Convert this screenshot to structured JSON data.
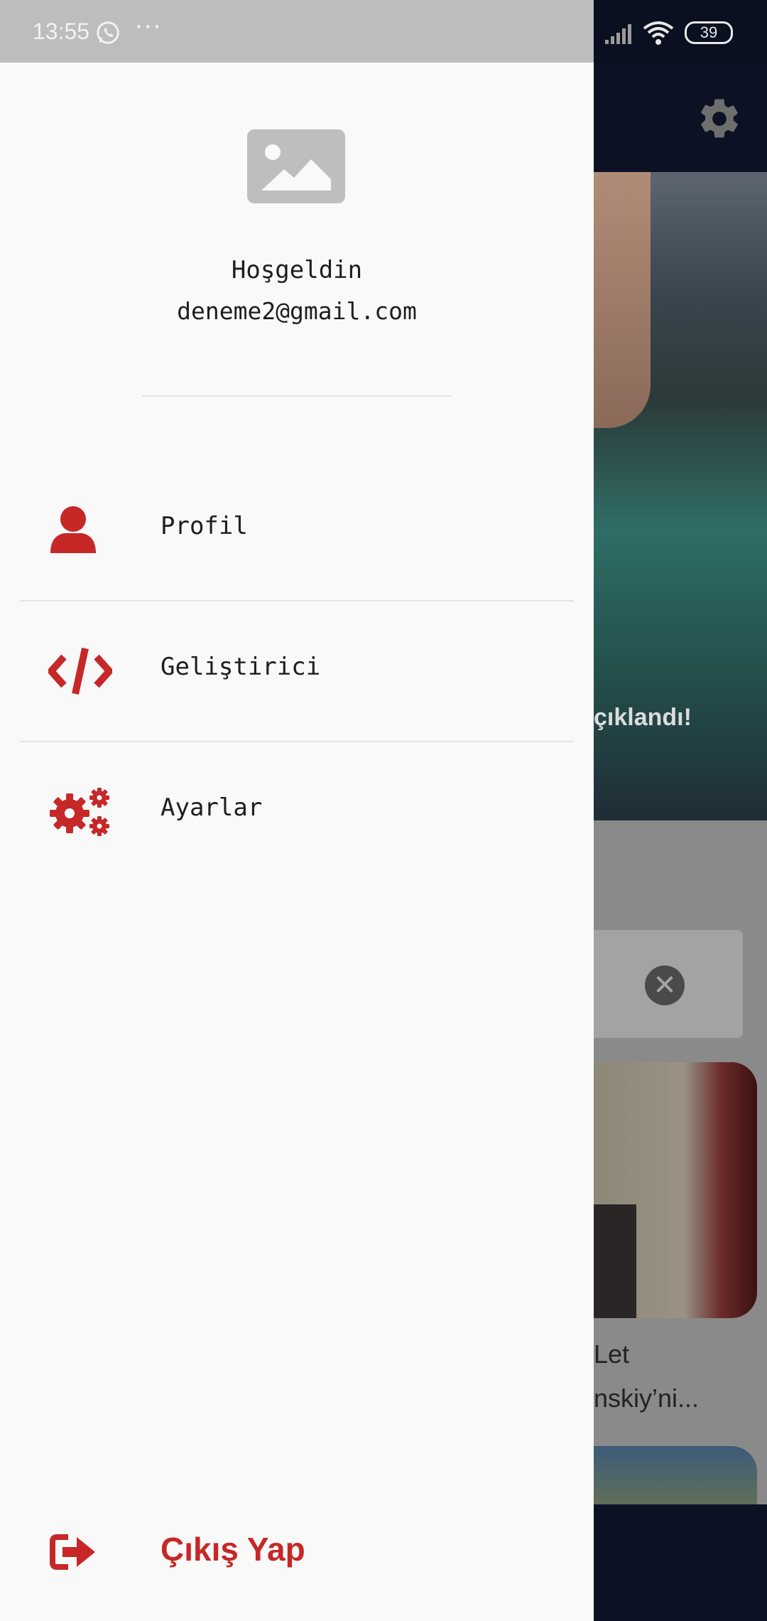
{
  "status_bar": {
    "time": "13:55",
    "more": "···",
    "battery": "39"
  },
  "drawer": {
    "greeting": "Hoşgeldin",
    "email": "deneme2@gmail.com",
    "items": [
      {
        "label": "Profil",
        "icon": "user-icon"
      },
      {
        "label": "Geliştirici",
        "icon": "code-icon"
      },
      {
        "label": "Ayarlar",
        "icon": "gears-icon"
      }
    ],
    "logout": {
      "label": "Çıkış Yap",
      "icon": "sign-out-icon"
    },
    "accent_color": "#c62828"
  },
  "background": {
    "hero_title": "çıklandı!",
    "close": "✕",
    "headline_line1": "Let",
    "headline_line2": "nskiy’ni..."
  }
}
